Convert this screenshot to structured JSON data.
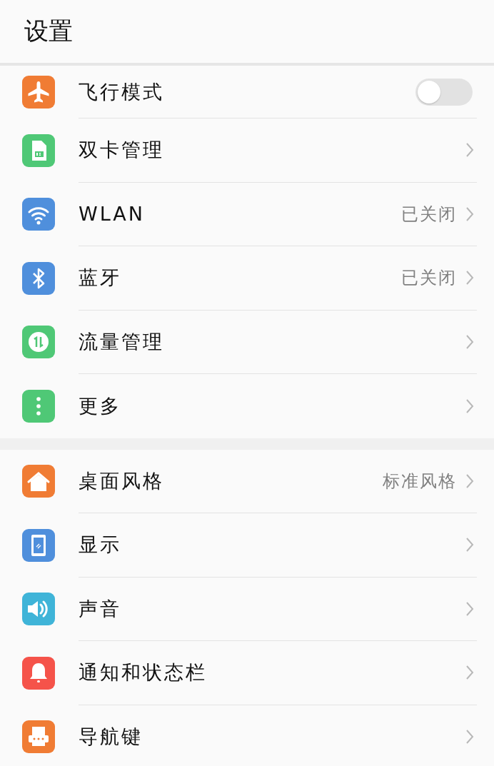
{
  "header": {
    "title": "设置"
  },
  "sections": [
    {
      "items": [
        {
          "kind": "toggle",
          "label": "飞行模式",
          "color": "#f07c34",
          "on": false
        },
        {
          "kind": "link",
          "label": "双卡管理",
          "color": "#4fc876"
        },
        {
          "kind": "link",
          "label": "WLAN",
          "color": "#4f8fdc",
          "value": "已关闭"
        },
        {
          "kind": "link",
          "label": "蓝牙",
          "color": "#4f8fdc",
          "value": "已关闭"
        },
        {
          "kind": "link",
          "label": "流量管理",
          "color": "#4fc876"
        },
        {
          "kind": "link",
          "label": "更多",
          "color": "#4fc876"
        }
      ]
    },
    {
      "items": [
        {
          "kind": "link",
          "label": "桌面风格",
          "color": "#f07c34",
          "value": "标准风格"
        },
        {
          "kind": "link",
          "label": "显示",
          "color": "#4f8fdc"
        },
        {
          "kind": "link",
          "label": "声音",
          "color": "#3fb4d8"
        },
        {
          "kind": "link",
          "label": "通知和状态栏",
          "color": "#f5534a"
        },
        {
          "kind": "link",
          "label": "导航键",
          "color": "#f07c34"
        }
      ]
    }
  ]
}
